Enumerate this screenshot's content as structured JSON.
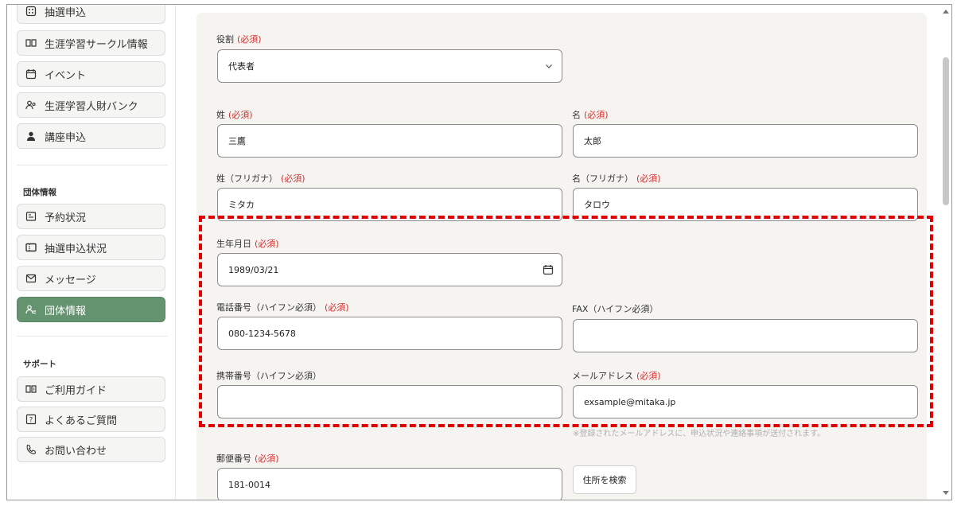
{
  "sidebar": {
    "items": [
      {
        "label": "抽選申込",
        "icon": "lottery-icon"
      },
      {
        "label": "生涯学習サークル情報",
        "icon": "book-icon"
      },
      {
        "label": "イベント",
        "icon": "calendar-icon"
      },
      {
        "label": "生涯学習人財バンク",
        "icon": "people-icon"
      },
      {
        "label": "講座申込",
        "icon": "user-icon"
      }
    ],
    "section_org": "団体情報",
    "org_items": [
      {
        "label": "予約状況",
        "icon": "reservation-icon"
      },
      {
        "label": "抽選申込状況",
        "icon": "ticket-icon"
      },
      {
        "label": "メッセージ",
        "icon": "mail-icon"
      },
      {
        "label": "団体情報",
        "icon": "group-icon"
      }
    ],
    "section_support": "サポート",
    "support_items": [
      {
        "label": "ご利用ガイド",
        "icon": "guide-icon"
      },
      {
        "label": "よくあるご質問",
        "icon": "help-icon"
      },
      {
        "label": "お問い合わせ",
        "icon": "phone-icon"
      }
    ]
  },
  "form": {
    "required": "(必須)",
    "role": {
      "label": "役割",
      "value": "代表者"
    },
    "last_name": {
      "label": "姓",
      "value": "三鷹"
    },
    "first_name": {
      "label": "名",
      "value": "太郎"
    },
    "last_kana": {
      "label": "姓（フリガナ）",
      "value": "ミタカ"
    },
    "first_kana": {
      "label": "名（フリガナ）",
      "value": "タロウ"
    },
    "birthdate": {
      "label": "生年月日",
      "value": "1989/03/21"
    },
    "phone": {
      "label": "電話番号（ハイフン必須）",
      "value": "080-1234-5678"
    },
    "fax": {
      "label": "FAX（ハイフン必須）",
      "value": ""
    },
    "mobile": {
      "label": "携帯番号（ハイフン必須）",
      "value": ""
    },
    "email": {
      "label": "メールアドレス",
      "value": "exsample@mitaka.jp"
    },
    "email_note": "※登録されたメールアドレスに、申込状況や連絡事項が送付されます。",
    "postal": {
      "label": "郵便番号",
      "value": "181-0014"
    },
    "address_search": "住所を検索"
  },
  "colors": {
    "accent": "#64936f",
    "required": "#d32f2f",
    "highlight": "#e00000"
  }
}
